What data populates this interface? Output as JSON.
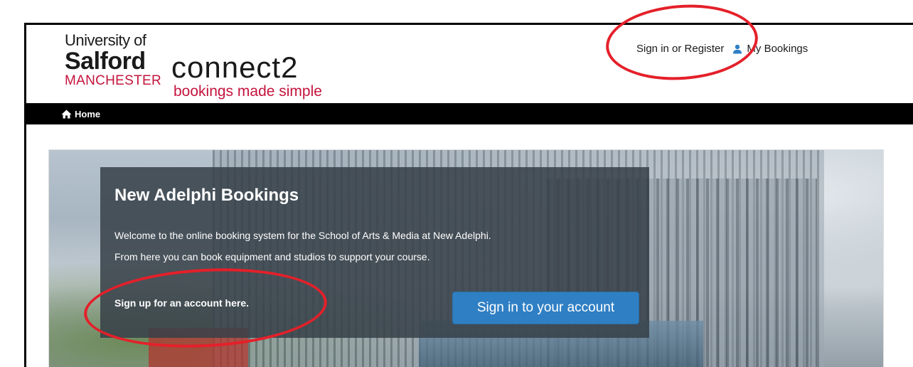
{
  "header": {
    "logo": {
      "line1": "University of",
      "line2": "Salford",
      "line3": "MANCHESTER",
      "brand": "connect2",
      "tagline": "bookings made simple"
    },
    "links": {
      "signin_register": "Sign in or Register",
      "my_bookings": "My Bookings"
    }
  },
  "nav": {
    "home_label": "Home"
  },
  "hero": {
    "title": "New Adelphi Bookings",
    "text1": "Welcome to the online booking system for the School of Arts & Media at New Adelphi.",
    "text2": "From here you can book equipment and studios to support your course.",
    "signup_link": "Sign up for an account here.",
    "signin_button": "Sign in to your account"
  },
  "colors": {
    "accent_red": "#c4143c",
    "button_blue": "#2f7fc4",
    "annotation_red": "#e4202a",
    "navbar": "#000000"
  },
  "icons": {
    "user": "user-icon",
    "home": "home-icon"
  }
}
